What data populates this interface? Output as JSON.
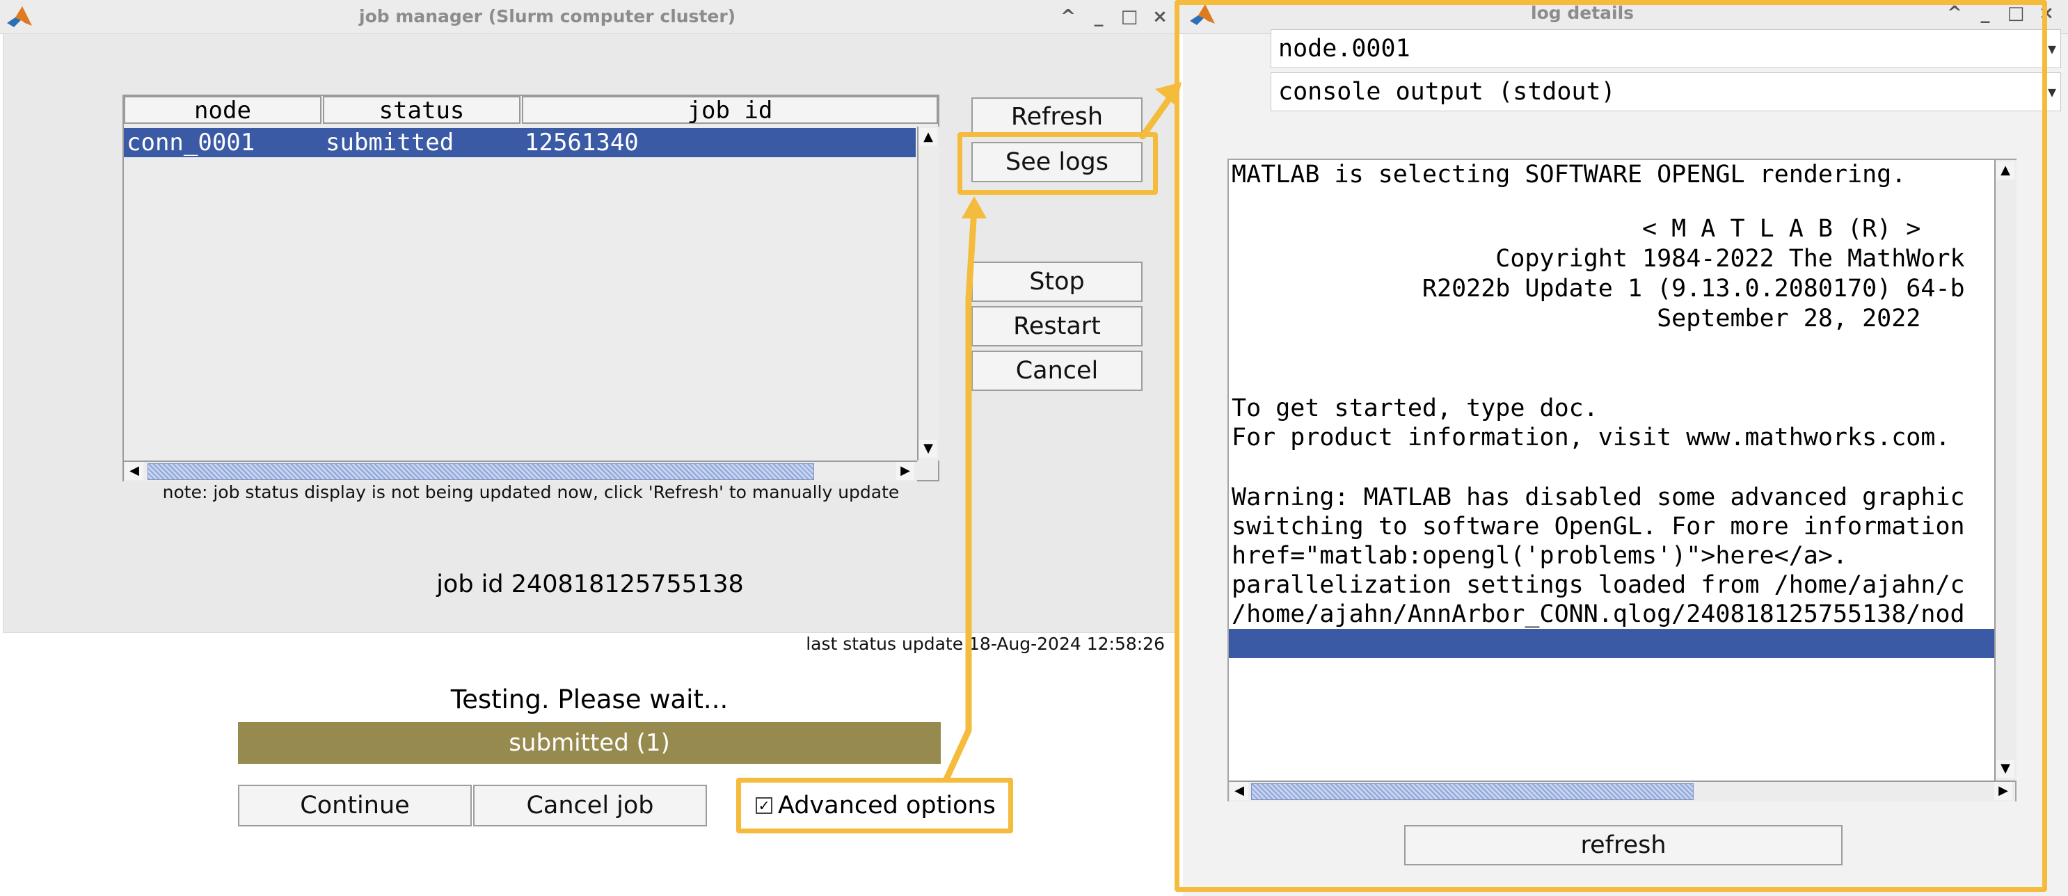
{
  "main_window": {
    "title": "job manager (Slurm computer cluster)",
    "controls": {
      "restore": "^",
      "minimize": "_",
      "maximize": "□",
      "close": "×"
    },
    "table": {
      "headers": [
        "node",
        "status",
        "job id"
      ],
      "rows": [
        {
          "node": "conn_0001",
          "status": "submitted",
          "job_id": "12561340"
        }
      ]
    },
    "buttons": {
      "refresh": "Refresh",
      "see_logs": "See logs",
      "stop": "Stop",
      "restart": "Restart",
      "cancel": "Cancel"
    },
    "note": "note: job status display is not being updated now, click 'Refresh' to manually update",
    "job_id_label": "job id 240818125755138",
    "last_status": "last status update 18-Aug-2024 12:58:26",
    "testing_text": "Testing. Please wait...",
    "progress_label": "submitted (1)",
    "continue_label": "Continue",
    "cancel_job_label": "Cancel job",
    "advanced_options_label": "Advanced options",
    "advanced_options_checked": true
  },
  "log_window": {
    "title": "log details",
    "controls": {
      "restore": "^",
      "minimize": "_",
      "maximize": "□",
      "close": "×"
    },
    "node_select": "node.0001",
    "output_select": "console output (stdout)",
    "log_lines": [
      "MATLAB is selecting SOFTWARE OPENGL rendering.",
      "",
      "                            < M A T L A B (R) >",
      "                  Copyright 1984-2022 The MathWork",
      "             R2022b Update 1 (9.13.0.2080170) 64-b",
      "                             September 28, 2022",
      "",
      "",
      "To get started, type doc.",
      "For product information, visit www.mathworks.com.",
      "",
      "Warning: MATLAB has disabled some advanced graphic",
      "switching to software OpenGL. For more information",
      "href=\"matlab:opengl('problems')\">here</a>.",
      "parallelization settings loaded from /home/ajahn/c",
      "/home/ajahn/AnnArbor_CONN.qlog/240818125755138/nod"
    ],
    "refresh_label": "refresh"
  },
  "colors": {
    "highlight": "#f4bb3d",
    "selection": "#3a5aa5",
    "progress": "#978a4e"
  }
}
